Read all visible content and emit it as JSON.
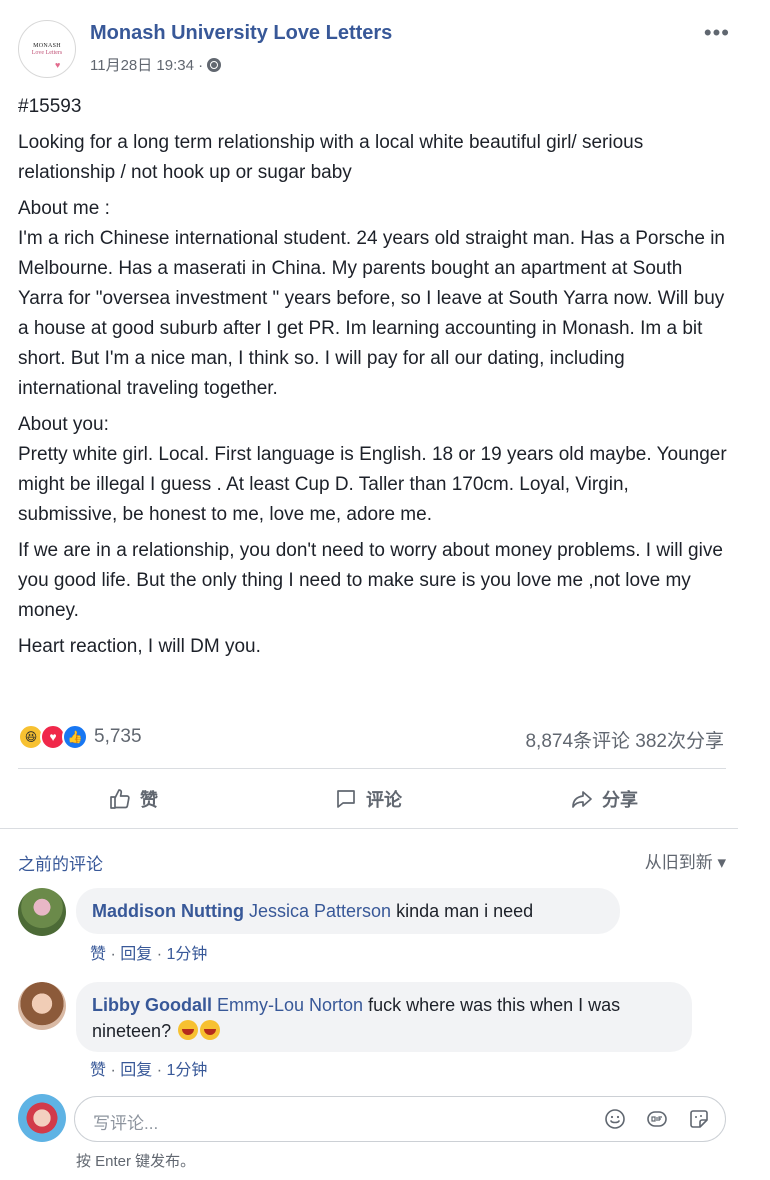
{
  "post": {
    "page_name": "Monash University Love Letters",
    "avatar_line1": "MONASH",
    "avatar_line2": "Love Letters",
    "timestamp": "11月28日 19:34 ·",
    "more_label": "•••",
    "paragraphs": [
      "#15593",
      "Looking for a long term relationship with a local white beautiful girl/ serious relationship / not hook up or sugar baby",
      "About me :\nI'm a rich Chinese international student. 24 years old straight man. Has a Porsche in Melbourne. Has a maserati in China. My parents bought an apartment at South Yarra for \"oversea investment \" years before, so I leave at South Yarra now. Will buy a house at good suburb after I get PR. Im learning accounting in Monash. Im a bit short. But I'm a nice man, I think so. I will pay for all our dating, including international traveling together.",
      "About you:\nPretty white girl. Local. First language is English. 18 or 19 years old maybe. Younger might be illegal I guess . At least Cup D. Taller than 170cm. Loyal, Virgin, submissive, be honest to me, love me, adore me.",
      "If we are in a relationship, you don't need to worry about money problems. I will give you good life. But the only thing I need to make sure is you love me ,not love my money.",
      "Heart reaction, I will DM you."
    ]
  },
  "stats": {
    "reaction_count": "5,735",
    "comments_shares": "8,874条评论  382次分享",
    "reaction_types": [
      "haha",
      "love",
      "like"
    ]
  },
  "actions": {
    "like_label": "赞",
    "comment_label": "评论",
    "share_label": "分享"
  },
  "comments_header": {
    "earlier_label": "之前的评论",
    "sort_label": "从旧到新 ▾"
  },
  "comments": [
    {
      "author": "Maddison Nutting",
      "mention": "Jessica Patterson",
      "text": " kinda man i need",
      "like_action": "赞",
      "reply_action": "回复",
      "time": "1分钟"
    },
    {
      "author": "Libby Goodall",
      "mention": "Emmy-Lou Norton",
      "text": " fuck where was this when I was nineteen?",
      "like_action": "赞",
      "reply_action": "回复",
      "time": "1分钟"
    }
  ],
  "composer": {
    "placeholder": "写评论...",
    "hint": "按 Enter 键发布。"
  },
  "colors": {
    "link_blue": "#385898",
    "secondary_text": "#616770",
    "bubble_bg": "#f2f3f5"
  }
}
